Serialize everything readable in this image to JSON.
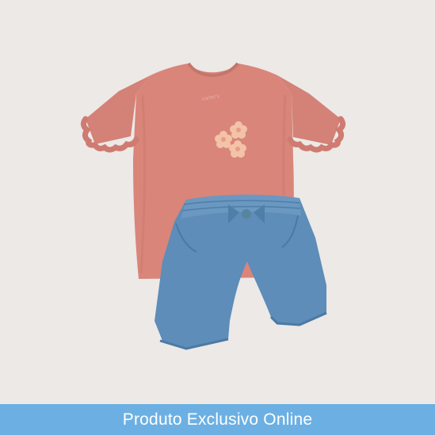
{
  "product": {
    "image_alt": "Conjunto infantil: blusa rosa com babados e short jeans",
    "tag_text": "carter's",
    "background_color": "#ece9e7",
    "shirt_color": "#d9857a",
    "shorts_color": "#5d8db8"
  },
  "banner": {
    "label": "Produto Exclusivo Online",
    "color": "#6cb0e3"
  }
}
